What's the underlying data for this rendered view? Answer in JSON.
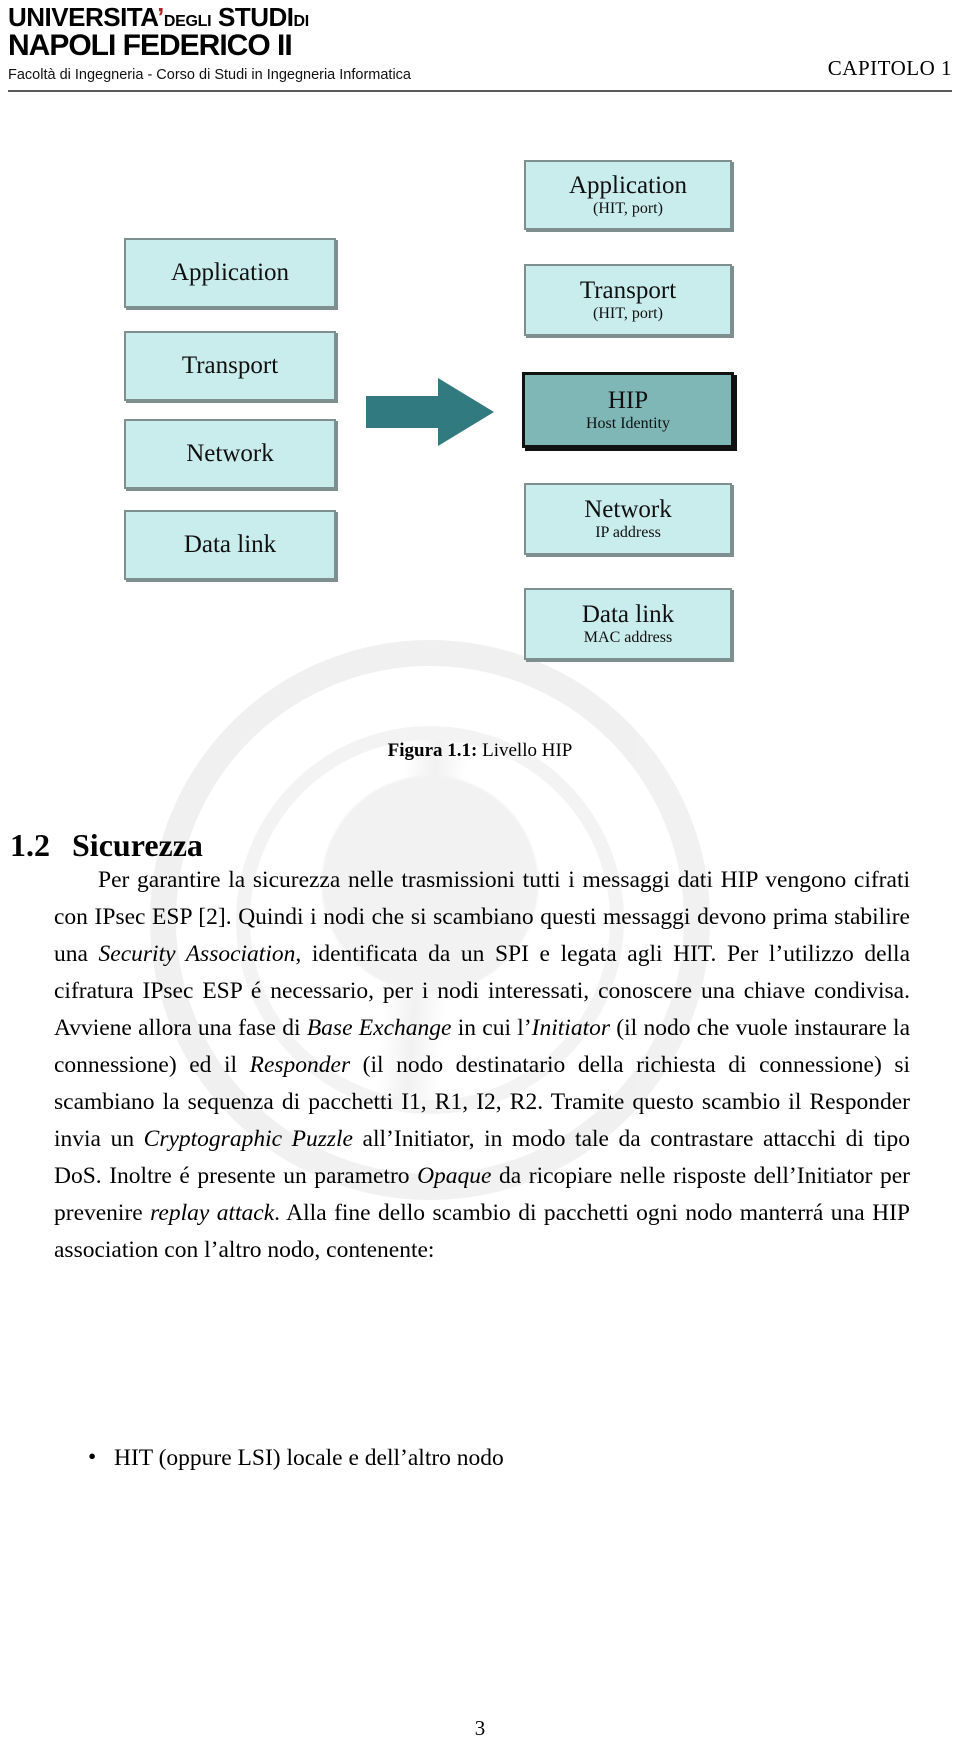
{
  "header": {
    "university_line1_main": "UNIVERSITA",
    "university_line1_apostrophe": "’",
    "university_line1_degli": "DEGLI",
    "university_line1_studi": "STUDI",
    "university_line1_di": "DI",
    "university_line2": "NAPOLI FEDERICO II",
    "faculty": "Facoltà di Ingegneria - Corso di Studi in Ingegneria Informatica",
    "chapter": "CAPITOLO 1"
  },
  "figure": {
    "caption_number": "Figura 1.1:",
    "caption_text": "Livello HIP",
    "left_stack": [
      {
        "title": "Application",
        "subtitle": ""
      },
      {
        "title": "Transport",
        "subtitle": ""
      },
      {
        "title": "Network",
        "subtitle": ""
      },
      {
        "title": "Data link",
        "subtitle": ""
      }
    ],
    "right_stack": [
      {
        "title": "Application",
        "subtitle": "(HIT, port)"
      },
      {
        "title": "Transport",
        "subtitle": "(HIT, port)"
      },
      {
        "title": "HIP",
        "subtitle": "Host Identity"
      },
      {
        "title": "Network",
        "subtitle": "IP address"
      },
      {
        "title": "Data link",
        "subtitle": "MAC address"
      }
    ],
    "arrow_label": "transformation-arrow",
    "colors": {
      "box_fill": "#c9ecec",
      "box_border": "#7d8f8f",
      "highlight_fill": "#7fb7b7",
      "highlight_border": "#111111",
      "arrow_fill": "#317b80"
    }
  },
  "section": {
    "number": "1.2",
    "title": "Sicurezza"
  },
  "body": {
    "paragraph_1_part1": "Per garantire la sicurezza nelle trasmissioni tutti i messaggi dati HIP vengono cifrati con IPsec ESP [2]. Quindi i nodi che si scambiano questi messaggi devono prima stabilire una ",
    "paragraph_1_em1": "Security Association",
    "paragraph_1_part2": ", identificata da un SPI e legata agli HIT. Per l’utilizzo della cifratura IPsec ESP é necessario, per i nodi interessati, conoscere una chiave condivisa. Avviene allora una fase di ",
    "paragraph_1_em2": "Base Exchange",
    "paragraph_1_part3": " in cui l’",
    "paragraph_1_em3": "Initiator",
    "paragraph_1_part4": " (il nodo che vuole instaurare la connessione) ed il ",
    "paragraph_1_em4": "Responder",
    "paragraph_1_part5": " (il nodo destinatario della richiesta di connessione) si scambiano la sequenza di pacchetti I1, R1, I2, R2. Tramite questo scambio il Responder invia un ",
    "paragraph_1_em5": "Cryptographic Puzzle",
    "paragraph_1_part6": " all’Initiator, in modo tale da contrastare attacchi di tipo DoS. Inoltre é presente un parametro ",
    "paragraph_1_em6": "Opaque",
    "paragraph_1_part7": " da ricopiare nelle risposte dell’Initiator per prevenire ",
    "paragraph_1_em7": "replay attack",
    "paragraph_1_part8": ". Alla fine dello scambio di pacchetti ogni nodo manterrá una HIP association con l’altro nodo, contenente:",
    "bullets": [
      "HIT (oppure LSI) locale e dell’altro nodo"
    ]
  },
  "footer": {
    "page_number": "3"
  }
}
